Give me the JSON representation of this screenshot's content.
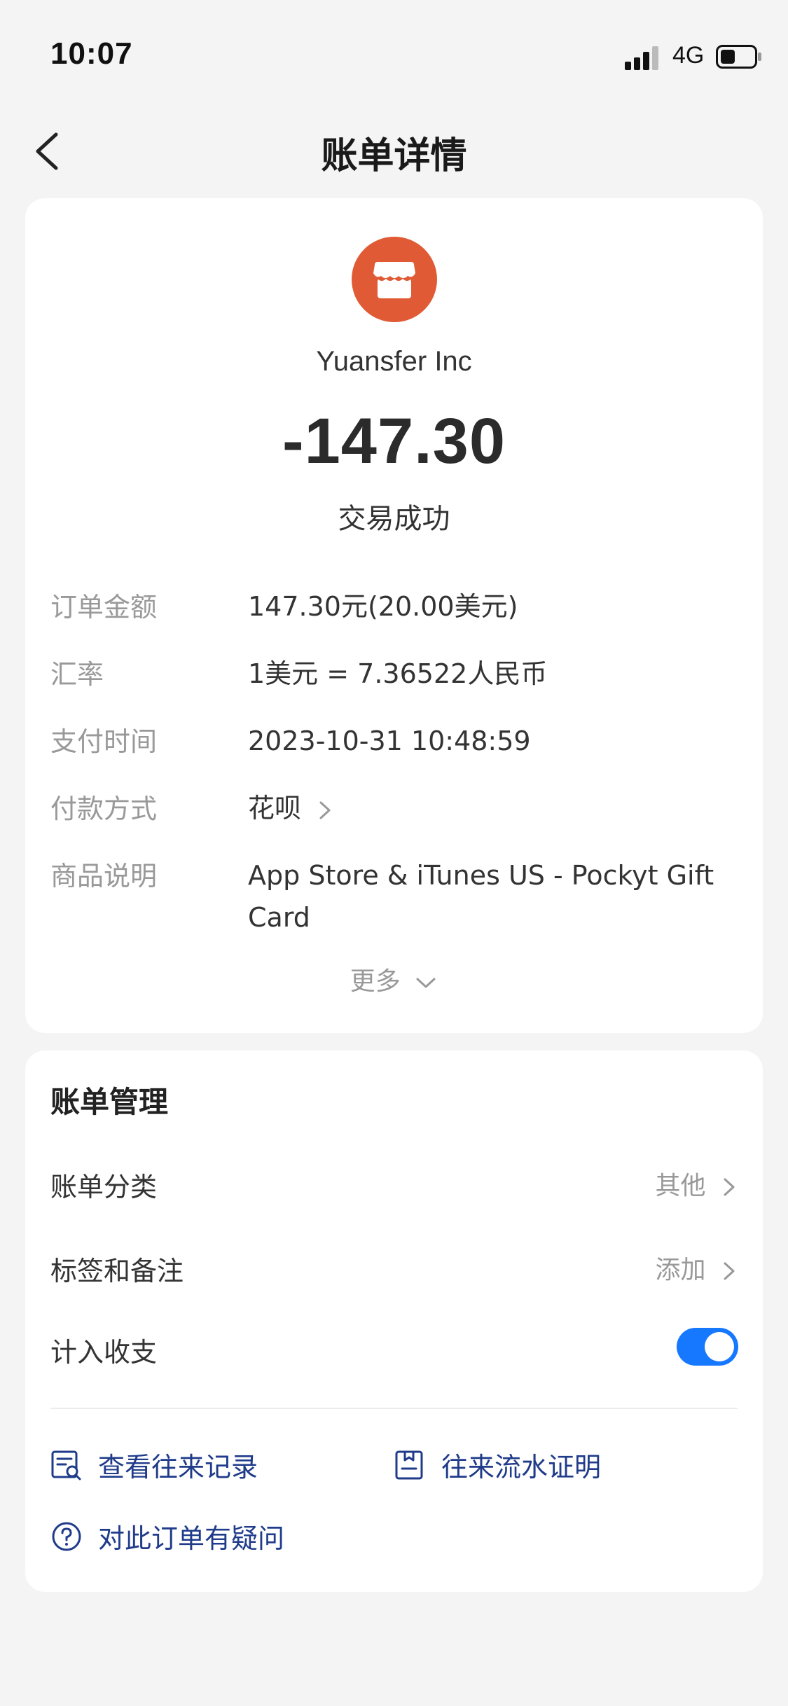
{
  "status_bar": {
    "time": "10:07",
    "network": "4G"
  },
  "nav": {
    "title": "账单详情"
  },
  "merchant": {
    "name": "Yuansfer Inc",
    "logo_color": "#E05B35"
  },
  "transaction": {
    "amount": "-147.30",
    "status": "交易成功"
  },
  "details": [
    {
      "label": "订单金额",
      "value": "147.30元(20.00美元)"
    },
    {
      "label": "汇率",
      "value": "1美元 = 7.36522人民币"
    },
    {
      "label": "支付时间",
      "value": "2023-10-31 10:48:59"
    },
    {
      "label": "付款方式",
      "value": "花呗"
    },
    {
      "label": "商品说明",
      "value": "App Store & iTunes US - Pockyt Gift Card"
    }
  ],
  "more_label": "更多",
  "management": {
    "title": "账单管理",
    "category": {
      "label": "账单分类",
      "value": "其他"
    },
    "tags": {
      "label": "标签和备注",
      "value": "添加"
    },
    "include": {
      "label": "计入收支",
      "enabled": true
    },
    "links": {
      "history": "查看往来记录",
      "proof": "往来流水证明",
      "question": "对此订单有疑问"
    }
  },
  "colors": {
    "accent": "#1677FF",
    "link": "#1F3B8A",
    "background": "#F4F4F4"
  }
}
